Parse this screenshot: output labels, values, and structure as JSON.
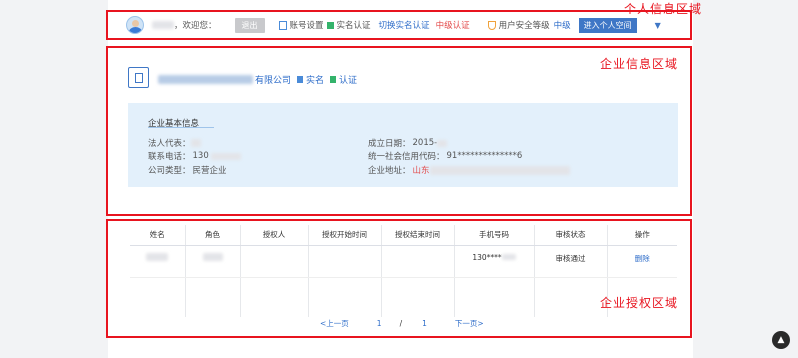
{
  "annotations": {
    "personal_area": "个人信息区域",
    "company_area": "企业信息区域",
    "auth_area": "企业授权区域"
  },
  "topbar": {
    "greeting": "，欢迎您：",
    "logout": "退出",
    "account_settings": "账号设置",
    "real_name": "实名认证",
    "switch_auth": "切换实名认证",
    "mid_level_auth": "中级认证",
    "security_label": "用户安全等级",
    "security_level": "中级",
    "personal_space": "进入个人空间",
    "caret": "▼"
  },
  "company": {
    "name_suffix": "有限公司",
    "tag1": "实名",
    "tag2": "认证",
    "info_title": "企业基本信息",
    "fields": {
      "legal_rep_label": "法人代表：",
      "phone_label": "联系电话：",
      "phone_value": "130",
      "company_type_label": "公司类型：",
      "company_type_value": "民营企业",
      "established_label": "成立日期：",
      "established_value": "2015-",
      "credit_code_label": "统一社会信用代码：",
      "credit_code_value": "91**************6",
      "address_label": "企业地址：",
      "address_value": "山东"
    }
  },
  "auth_table": {
    "headers": [
      "姓名",
      "角色",
      "授权人",
      "授权开始时间",
      "授权结束时间",
      "手机号码",
      "审核状态",
      "操作"
    ],
    "rows": [
      {
        "phone": "130****",
        "status": "审核通过",
        "action": "删除"
      }
    ]
  },
  "pager": {
    "prev": "<上一页",
    "page": "1",
    "sep": "/",
    "total": "1",
    "next": "下一页>"
  },
  "scroll_top": "▲"
}
